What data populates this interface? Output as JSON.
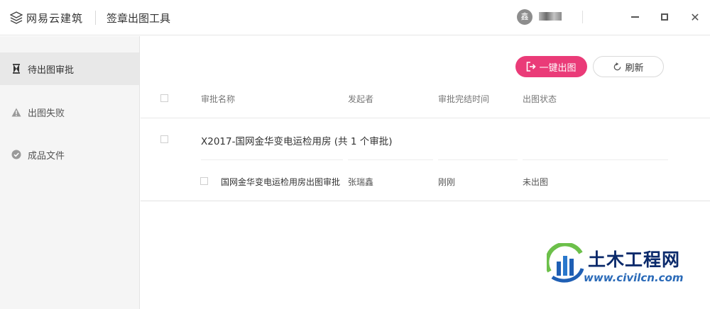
{
  "titlebar": {
    "brand_name": "网易云建筑",
    "app_title": "签章出图工具",
    "avatar_letter": "鑫",
    "min_icon": "minimize-icon",
    "max_icon": "maximize-icon",
    "close_icon": "close-icon",
    "close_glyph": "✕"
  },
  "sidebar": {
    "items": [
      {
        "label": "待出图审批",
        "icon": "hourglass-icon",
        "active": true
      },
      {
        "label": "出图失败",
        "icon": "warning-icon",
        "active": false
      },
      {
        "label": "成品文件",
        "icon": "check-circle-icon",
        "active": false
      }
    ]
  },
  "toolbar": {
    "export_label": "一键出图",
    "refresh_label": "刷新"
  },
  "table": {
    "columns": [
      "审批名称",
      "发起者",
      "审批完结时间",
      "出图状态"
    ],
    "groups": [
      {
        "title": "X2017-国网金华变电运检用房 (共 1 个审批)",
        "rows": [
          {
            "name": "国网金华变电运检用房出图审批",
            "initiator": "张瑞鑫",
            "finished_time": "刚刚",
            "status": "未出图"
          }
        ]
      }
    ]
  },
  "watermark": {
    "title": "土木工程网",
    "url": "www.civilcn.com"
  },
  "colors": {
    "accent": "#ea3b78",
    "sidebar_bg": "#f5f5f5",
    "sidebar_active": "#e8e8e8"
  }
}
